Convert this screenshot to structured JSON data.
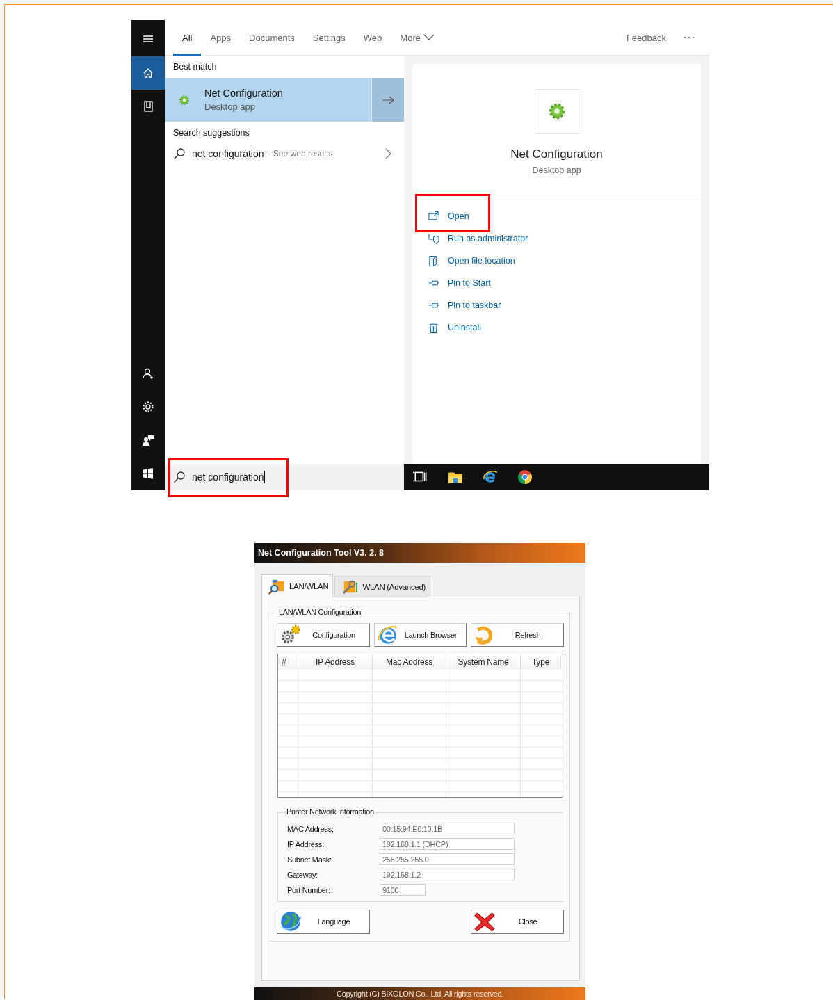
{
  "search_window": {
    "rail": {
      "top": [
        {
          "kind": "menu",
          "selected": false
        },
        {
          "kind": "home",
          "selected": true
        },
        {
          "kind": "notebook",
          "selected": false
        }
      ],
      "bottom": [
        {
          "kind": "person",
          "selected": false
        },
        {
          "kind": "settings",
          "selected": false
        },
        {
          "kind": "feedback",
          "selected": false
        },
        {
          "kind": "start",
          "selected": false
        }
      ]
    },
    "tabs": [
      {
        "label": "All",
        "kind": "tab",
        "selected": true
      },
      {
        "label": "Apps",
        "kind": "tab",
        "selected": false
      },
      {
        "label": "Documents",
        "kind": "tab",
        "selected": false
      },
      {
        "label": "Settings",
        "kind": "tab",
        "selected": false
      },
      {
        "label": "Web",
        "kind": "tab",
        "selected": false
      },
      {
        "label": "More",
        "kind": "dropdown",
        "selected": false
      }
    ],
    "feedback": "Feedback",
    "best_match": {
      "heading": "Best match",
      "title": "Net Configuration",
      "subtitle": "Desktop app",
      "selected": true
    },
    "suggestions": {
      "heading": "Search suggestions",
      "items": [
        {
          "query": "net configuration",
          "hint": "- See web results"
        }
      ]
    },
    "preview": {
      "title": "Net Configuration",
      "subtitle": "Desktop app",
      "actions": [
        {
          "kind": "open",
          "label": "Open"
        },
        {
          "kind": "admin",
          "label": "Run as administrator"
        },
        {
          "kind": "location",
          "label": "Open file location"
        },
        {
          "kind": "pin",
          "label": "Pin to Start"
        },
        {
          "kind": "pin",
          "label": "Pin to taskbar"
        },
        {
          "kind": "trash",
          "label": "Uninstall"
        }
      ]
    },
    "search_box": {
      "value": "net configuration"
    },
    "taskbar": [
      {
        "kind": "task_view"
      },
      {
        "kind": "explorer"
      },
      {
        "kind": "edge"
      },
      {
        "kind": "chrome"
      }
    ]
  },
  "config_tool": {
    "title": "Net Configuration Tool V3. 2. 8",
    "tabs": [
      {
        "label": "LAN/WLAN",
        "kind": "lan",
        "selected": true
      },
      {
        "label": "WLAN (Advanced)",
        "kind": "wlan",
        "selected": false
      }
    ],
    "group": "LAN/WLAN Configuration",
    "buttons": [
      {
        "kind": "gears",
        "label": "Configuration"
      },
      {
        "kind": "browser",
        "label": "Launch Browser"
      },
      {
        "kind": "refresh",
        "label": "Refresh"
      }
    ],
    "table": {
      "columns": [
        "#",
        "IP Address",
        "Mac Address",
        "System Name",
        "Type"
      ]
    },
    "info": {
      "heading": "Printer Network Information",
      "fields": [
        {
          "label": "MAC Address:",
          "value": "00:15:94:E0:10:1B",
          "kind": "wide"
        },
        {
          "label": "IP Address:",
          "value": "192.168.1.1 (DHCP)",
          "kind": "wide"
        },
        {
          "label": "Subnet Mask:",
          "value": "255.255.255.0",
          "kind": "wide"
        },
        {
          "label": "Gateway:",
          "value": "192.168.1.2",
          "kind": "wide"
        },
        {
          "label": "Port Number:",
          "value": "9100",
          "kind": "short"
        }
      ]
    },
    "bottom_buttons": [
      {
        "kind": "language",
        "label": "Language"
      },
      {
        "kind": "close",
        "label": "Close"
      }
    ],
    "footer": "Copyright (C) BIXOLON Co., Ltd. All rights reserved."
  }
}
